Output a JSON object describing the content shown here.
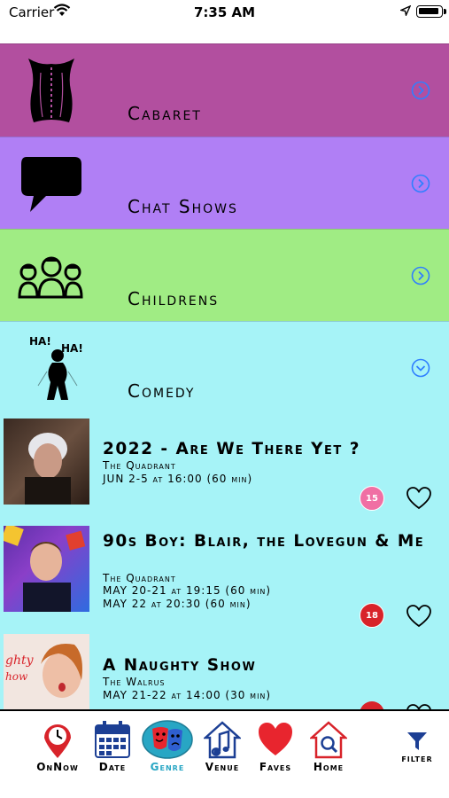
{
  "status_bar": {
    "carrier": "Carrier",
    "time": "7:35 AM"
  },
  "genres": [
    {
      "label": "Cabaret",
      "expanded": false
    },
    {
      "label": "Chat Shows",
      "expanded": false
    },
    {
      "label": "Childrens",
      "expanded": false
    },
    {
      "label": "Comedy",
      "expanded": true
    }
  ],
  "comedy_shows": [
    {
      "title": "2022 - Are We There Yet ?",
      "venue": "The Quadrant",
      "dates": [
        "JUN 2-5 at 16:00 (60 min)"
      ],
      "rating": "15",
      "rating_color": "#f06fa4"
    },
    {
      "title": "90s Boy: Blair, the Lovegun & Me",
      "venue": "The Quadrant",
      "dates": [
        "MAY 20-21 at 19:15 (60 min)",
        "MAY 22 at 20:30 (60 min)"
      ],
      "rating": "18",
      "rating_color": "#d8232a"
    },
    {
      "title": "A Naughty Show",
      "venue": "The Walrus",
      "dates": [
        "MAY 21-22 at 14:00 (30 min)"
      ],
      "rating": "",
      "rating_color": "#d8232a"
    }
  ],
  "tabs": [
    {
      "label": "OnNow",
      "icon": "map-pin-clock-icon",
      "active": false
    },
    {
      "label": "Date",
      "icon": "calendar-icon",
      "active": false
    },
    {
      "label": "Genre",
      "icon": "theatre-masks-icon",
      "active": true
    },
    {
      "label": "Venue",
      "icon": "house-music-note-icon",
      "active": false
    },
    {
      "label": "Faves",
      "icon": "heart-icon",
      "active": false
    },
    {
      "label": "Home",
      "icon": "house-search-icon",
      "active": false
    }
  ],
  "filter_label": "FILTER",
  "colors": {
    "cabaret": "#b24f9f",
    "chat_shows": "#b07ff5",
    "childrens": "#a0ec84",
    "comedy": "#a6f3f7",
    "chevron": "#2f7fff",
    "active_tab": "#28a6c4"
  }
}
